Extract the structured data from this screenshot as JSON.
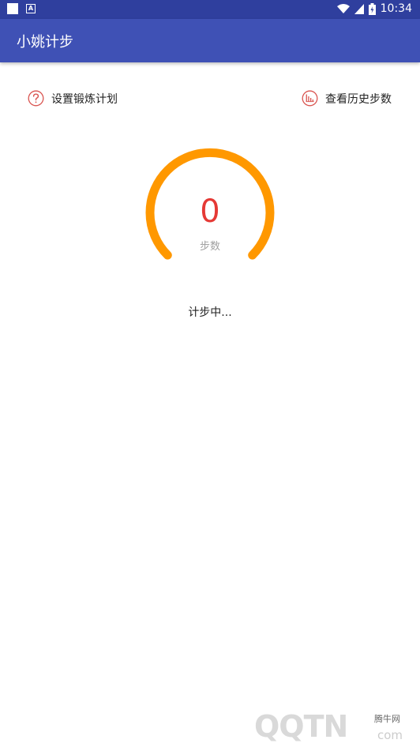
{
  "status_bar": {
    "time": "10:34",
    "notif_a": "A"
  },
  "app_bar": {
    "title": "小姚计步"
  },
  "actions": {
    "plan_label": "设置锻炼计划",
    "history_label": "查看历史步数",
    "icon_color": "#d9534f"
  },
  "gauge": {
    "value": "0",
    "label": "步数",
    "arc_color": "#ff9800",
    "value_color": "#e53935"
  },
  "counting_status": "计步中...",
  "watermark": {
    "main": "QQTN",
    "tag": "腾牛网",
    "sub": "com"
  }
}
